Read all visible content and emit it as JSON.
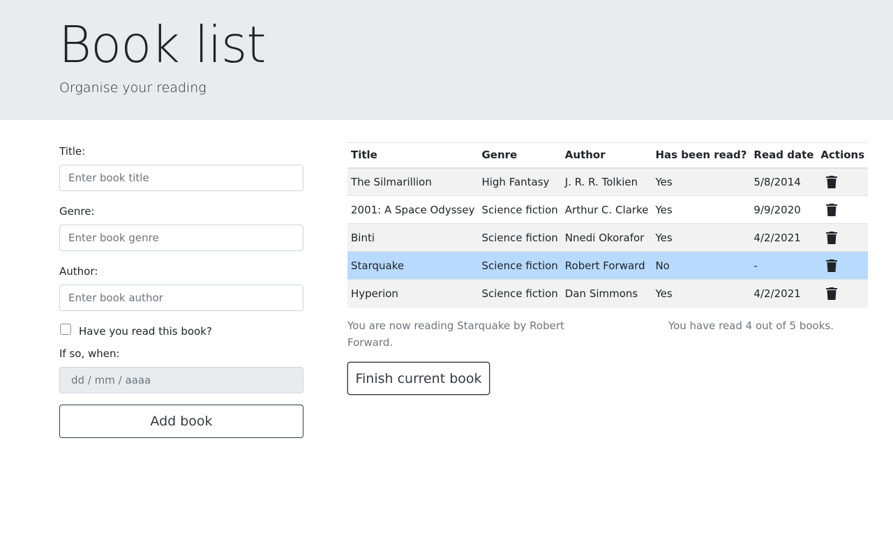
{
  "header": {
    "title": "Book list",
    "subtitle": "Organise your reading"
  },
  "form": {
    "title_label": "Title:",
    "title_placeholder": "Enter book title",
    "genre_label": "Genre:",
    "genre_placeholder": "Enter book genre",
    "author_label": "Author:",
    "author_placeholder": "Enter book author",
    "read_checkbox_label": "Have you read this book?",
    "read_checked": false,
    "date_label": "If so, when:",
    "date_placeholder": "dd / mm / aaaa",
    "add_button": "Add book"
  },
  "table": {
    "headers": [
      "Title",
      "Genre",
      "Author",
      "Has been read?",
      "Read date",
      "Actions"
    ],
    "rows": [
      {
        "title": "The Silmarillion",
        "genre": "High Fantasy",
        "author": "J. R. R. Tolkien",
        "read": "Yes",
        "date": "5/8/2014",
        "active": false
      },
      {
        "title": "2001: A Space Odyssey",
        "genre": "Science fiction",
        "author": "Arthur C. Clarke",
        "read": "Yes",
        "date": "9/9/2020",
        "active": false
      },
      {
        "title": "Binti",
        "genre": "Science fiction",
        "author": "Nnedi Okorafor",
        "read": "Yes",
        "date": "4/2/2021",
        "active": false
      },
      {
        "title": "Starquake",
        "genre": "Science fiction",
        "author": "Robert Forward",
        "read": "No",
        "date": "-",
        "active": true
      },
      {
        "title": "Hyperion",
        "genre": "Science fiction",
        "author": "Dan Simmons",
        "read": "Yes",
        "date": "4/2/2021",
        "active": false
      }
    ],
    "delete_icon": "trash-icon"
  },
  "status": {
    "current_reading": "You are now reading Starquake by Robert Forward.",
    "read_count": "You have read 4 out of 5 books."
  },
  "finish_button": "Finish current book",
  "colors": {
    "header_bg": "#e9ecef",
    "active_row": "#b8daff",
    "striped_row": "#f2f2f2"
  }
}
